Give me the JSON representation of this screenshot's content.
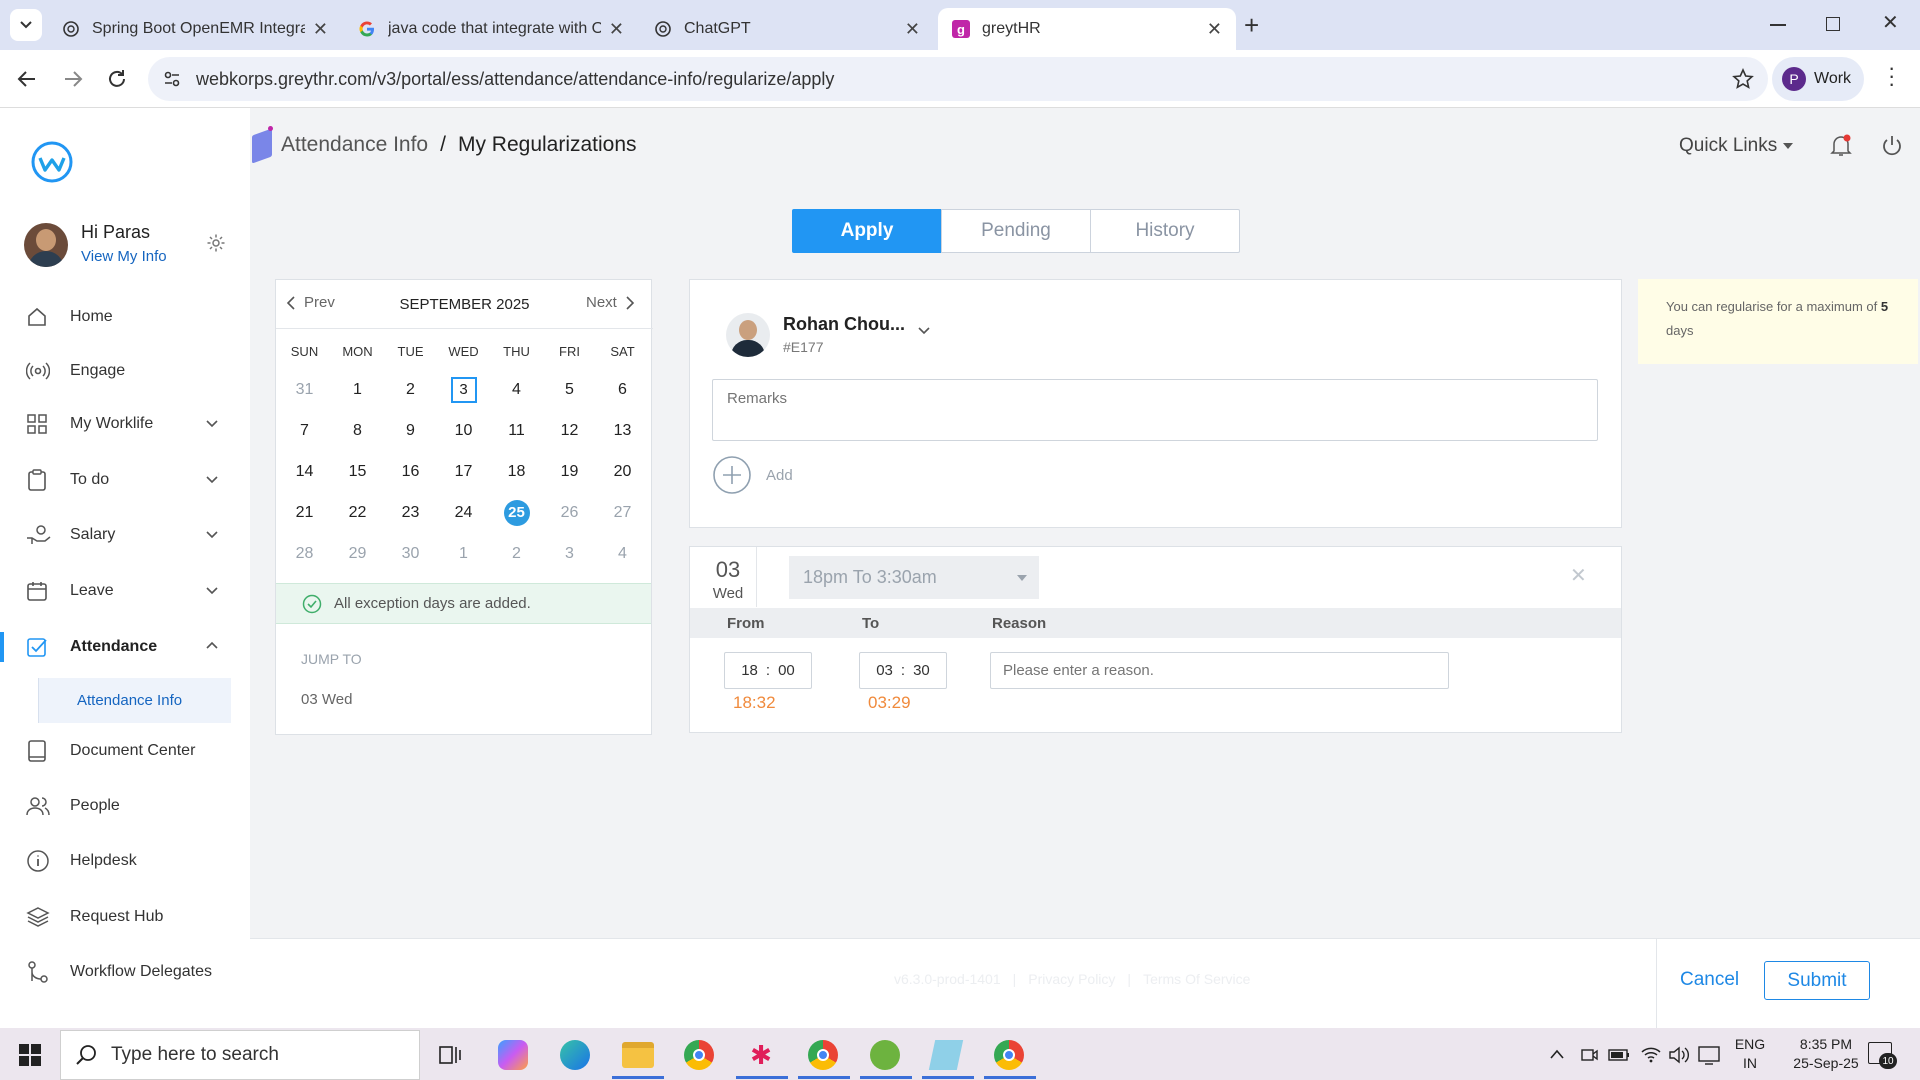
{
  "browser": {
    "tabs": [
      {
        "title": "Spring Boot OpenEMR Integrati",
        "icon": "chatgpt-icon"
      },
      {
        "title": "java code that integrate with Op",
        "icon": "google-icon"
      },
      {
        "title": "ChatGPT",
        "icon": "chatgpt-icon"
      },
      {
        "title": "greytHR",
        "icon": "greythr-icon"
      }
    ],
    "url": "webkorps.greythr.com/v3/portal/ess/attendance/attendance-info/regularize/apply",
    "profile_initial": "P",
    "profile_label": "Work"
  },
  "user": {
    "greeting": "Hi Paras",
    "view_info": "View My Info"
  },
  "sidebar": {
    "items": [
      {
        "label": "Home",
        "icon": "home-icon"
      },
      {
        "label": "Engage",
        "icon": "broadcast-icon"
      },
      {
        "label": "My Worklife",
        "icon": "grid-icon"
      },
      {
        "label": "To do",
        "icon": "clipboard-icon"
      },
      {
        "label": "Salary",
        "icon": "salary-icon"
      },
      {
        "label": "Leave",
        "icon": "calendar-icon"
      },
      {
        "label": "Attendance",
        "icon": "attendance-icon"
      },
      {
        "label": "Attendance Info",
        "icon": ""
      },
      {
        "label": "Document Center",
        "icon": "book-icon"
      },
      {
        "label": "People",
        "icon": "people-icon"
      },
      {
        "label": "Helpdesk",
        "icon": "info-icon"
      },
      {
        "label": "Request Hub",
        "icon": "layers-icon"
      },
      {
        "label": "Workflow Delegates",
        "icon": "workflow-icon"
      }
    ]
  },
  "header": {
    "breadcrumb_parent": "Attendance Info",
    "breadcrumb_sep": "/",
    "breadcrumb_current": "My Regularizations",
    "quick_links": "Quick Links"
  },
  "tabs": {
    "apply": "Apply",
    "pending": "Pending",
    "history": "History"
  },
  "calendar": {
    "prev": "Prev",
    "next": "Next",
    "month": "SEPTEMBER 2025",
    "days_of_week": [
      "SUN",
      "MON",
      "TUE",
      "WED",
      "THU",
      "FRI",
      "SAT"
    ],
    "weeks": [
      [
        "31",
        "1",
        "2",
        "3",
        "4",
        "5",
        "6"
      ],
      [
        "7",
        "8",
        "9",
        "10",
        "11",
        "12",
        "13"
      ],
      [
        "14",
        "15",
        "16",
        "17",
        "18",
        "19",
        "20"
      ],
      [
        "21",
        "22",
        "23",
        "24",
        "25",
        "26",
        "27"
      ],
      [
        "28",
        "29",
        "30",
        "1",
        "2",
        "3",
        "4"
      ]
    ],
    "exception_msg": "All exception days are added.",
    "jump_to": "JUMP TO",
    "jump_item": "03 Wed"
  },
  "employee": {
    "name": "Rohan Chou...",
    "id": "#E177"
  },
  "remarks_placeholder": "Remarks",
  "add_label": "Add",
  "entry": {
    "day_num": "03",
    "day_name": "Wed",
    "shift": "18pm To 3:30am",
    "col_from": "From",
    "col_to": "To",
    "col_reason": "Reason",
    "from_hh": "18",
    "from_mm": "00",
    "to_hh": "03",
    "to_mm": "30",
    "time_sep": ":",
    "actual_in": "18:32",
    "actual_out": "03:29",
    "reason_placeholder": "Please enter a reason."
  },
  "info_note": {
    "text": "You can regularise for a maximum of ",
    "count": "5",
    "suffix": "days"
  },
  "footer": {
    "version": "v6.3.0-prod-1401",
    "privacy": "Privacy Policy",
    "terms": "Terms Of Service",
    "sep": "|",
    "cancel": "Cancel",
    "submit": "Submit"
  },
  "taskbar": {
    "search_placeholder": "Type here to search",
    "lang1": "ENG",
    "lang2": "IN",
    "time": "8:35 PM",
    "date": "25-Sep-25",
    "notif_count": "10"
  },
  "colors": {
    "accent": "#2196f3",
    "link": "#1565c0",
    "orange": "#f08a3c",
    "success_bg": "#eaf6ef",
    "note_bg": "#fffde7"
  }
}
